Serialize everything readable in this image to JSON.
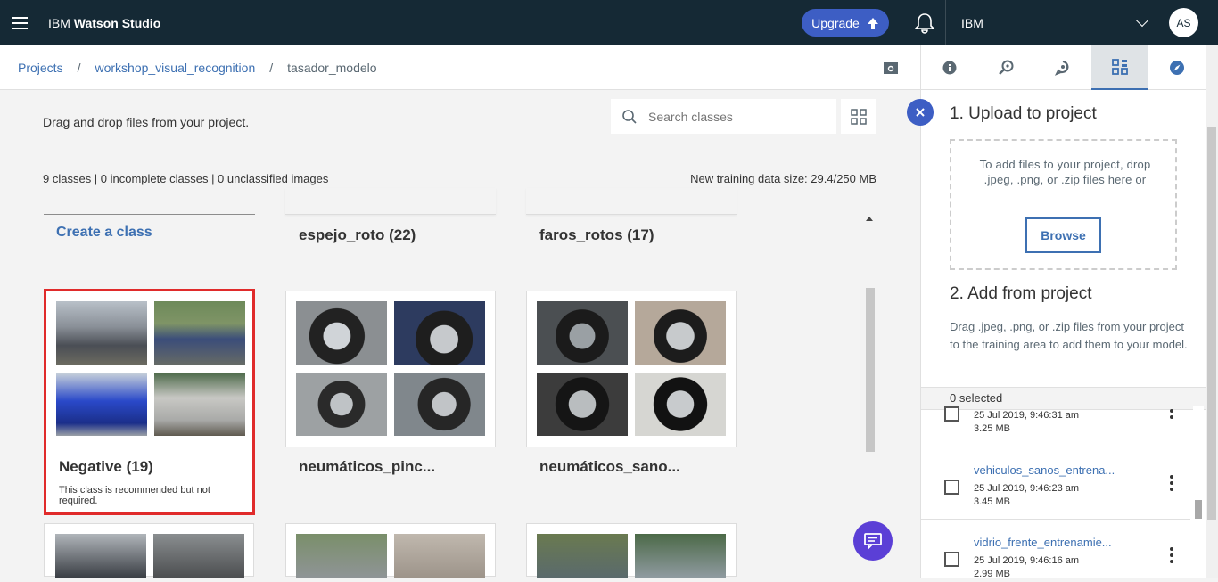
{
  "topbar": {
    "brand_prefix": "IBM ",
    "brand_name": "Watson Studio",
    "upgrade_label": "Upgrade",
    "account_name": "IBM",
    "avatar_initials": "AS"
  },
  "breadcrumb": {
    "items": [
      "Projects",
      "workshop_visual_recognition",
      "tasador_modelo"
    ],
    "separator": "/"
  },
  "main": {
    "hint": "Drag and drop files from your project.",
    "search_placeholder": "Search classes",
    "stats": "9 classes | 0 incomplete classes | 0 unclassified images",
    "data_size": "New training data size: 29.4/250 MB",
    "create_class_label": "Create a class",
    "top_classes": [
      "espejo_roto (22)",
      "faros_rotos (17)"
    ],
    "classes": [
      {
        "title": "Negative (19)",
        "note": "This class is recommended but not required."
      },
      {
        "title": "neumáticos_pinc..."
      },
      {
        "title": "neumáticos_sano..."
      }
    ]
  },
  "right_panel": {
    "tabs": [
      "info-icon",
      "search-model-icon",
      "hook-icon",
      "data-icon",
      "compass-icon"
    ],
    "upload_heading": "1. Upload to project",
    "dropzone_text": "To add files to your project, drop .jpeg, .png, or .zip files here or",
    "browse_label": "Browse",
    "add_heading": "2. Add from project",
    "add_text": "Drag .jpeg, .png, or .zip files from your project to the training area to add them to your model.",
    "selected_label": "0 selected",
    "files": [
      {
        "name": "",
        "date": "25 Jul 2019, 9:46:31 am",
        "size": "3.25 MB"
      },
      {
        "name": "vehiculos_sanos_entrena...",
        "date": "25 Jul 2019, 9:46:23 am",
        "size": "3.45 MB"
      },
      {
        "name": "vidrio_frente_entrenamie...",
        "date": "25 Jul 2019, 9:46:16 am",
        "size": "2.99 MB"
      }
    ]
  },
  "colors": {
    "topbar": "#152935",
    "accent": "#3d70b2",
    "upgrade": "#3d5ec4",
    "highlight": "#e02b2b",
    "chat": "#5b3fd6"
  }
}
